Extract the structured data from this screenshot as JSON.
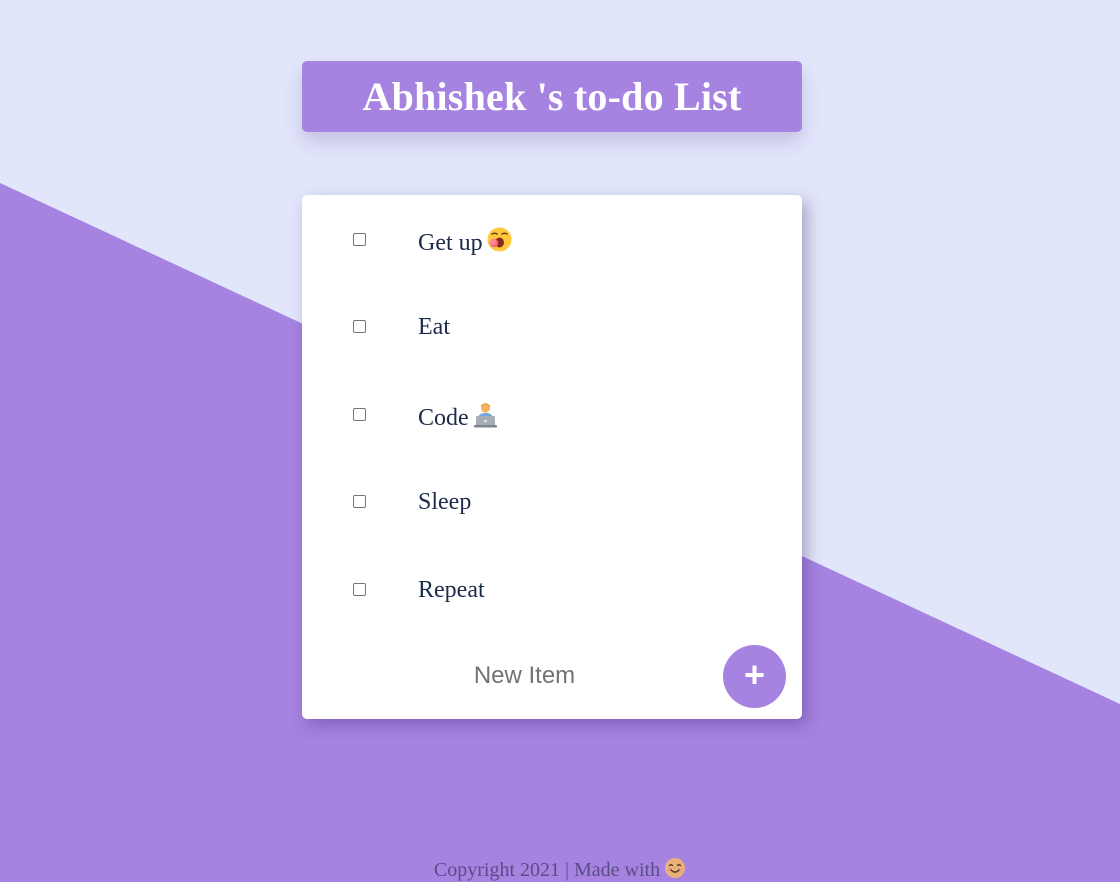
{
  "heading": {
    "title": "Abhishek 's to-do List"
  },
  "todo": {
    "items": [
      {
        "label": "Get up",
        "checked": false,
        "emoji_icon": "yawning-face-icon"
      },
      {
        "label": "Eat",
        "checked": false
      },
      {
        "label": "Code",
        "checked": false,
        "emoji_icon": "technologist-icon"
      },
      {
        "label": "Sleep",
        "checked": false
      },
      {
        "label": "Repeat",
        "checked": false
      }
    ],
    "new_item_placeholder": "New Item",
    "add_button_label": "+"
  },
  "footer": {
    "text": "Copyright 2021 | Made with",
    "emoji_icon": "smiling-face-icon"
  },
  "colors": {
    "background": "#e2e6fb",
    "accent": "#a683e1",
    "card": "#ffffff",
    "item_text": "#1c2b4a"
  }
}
